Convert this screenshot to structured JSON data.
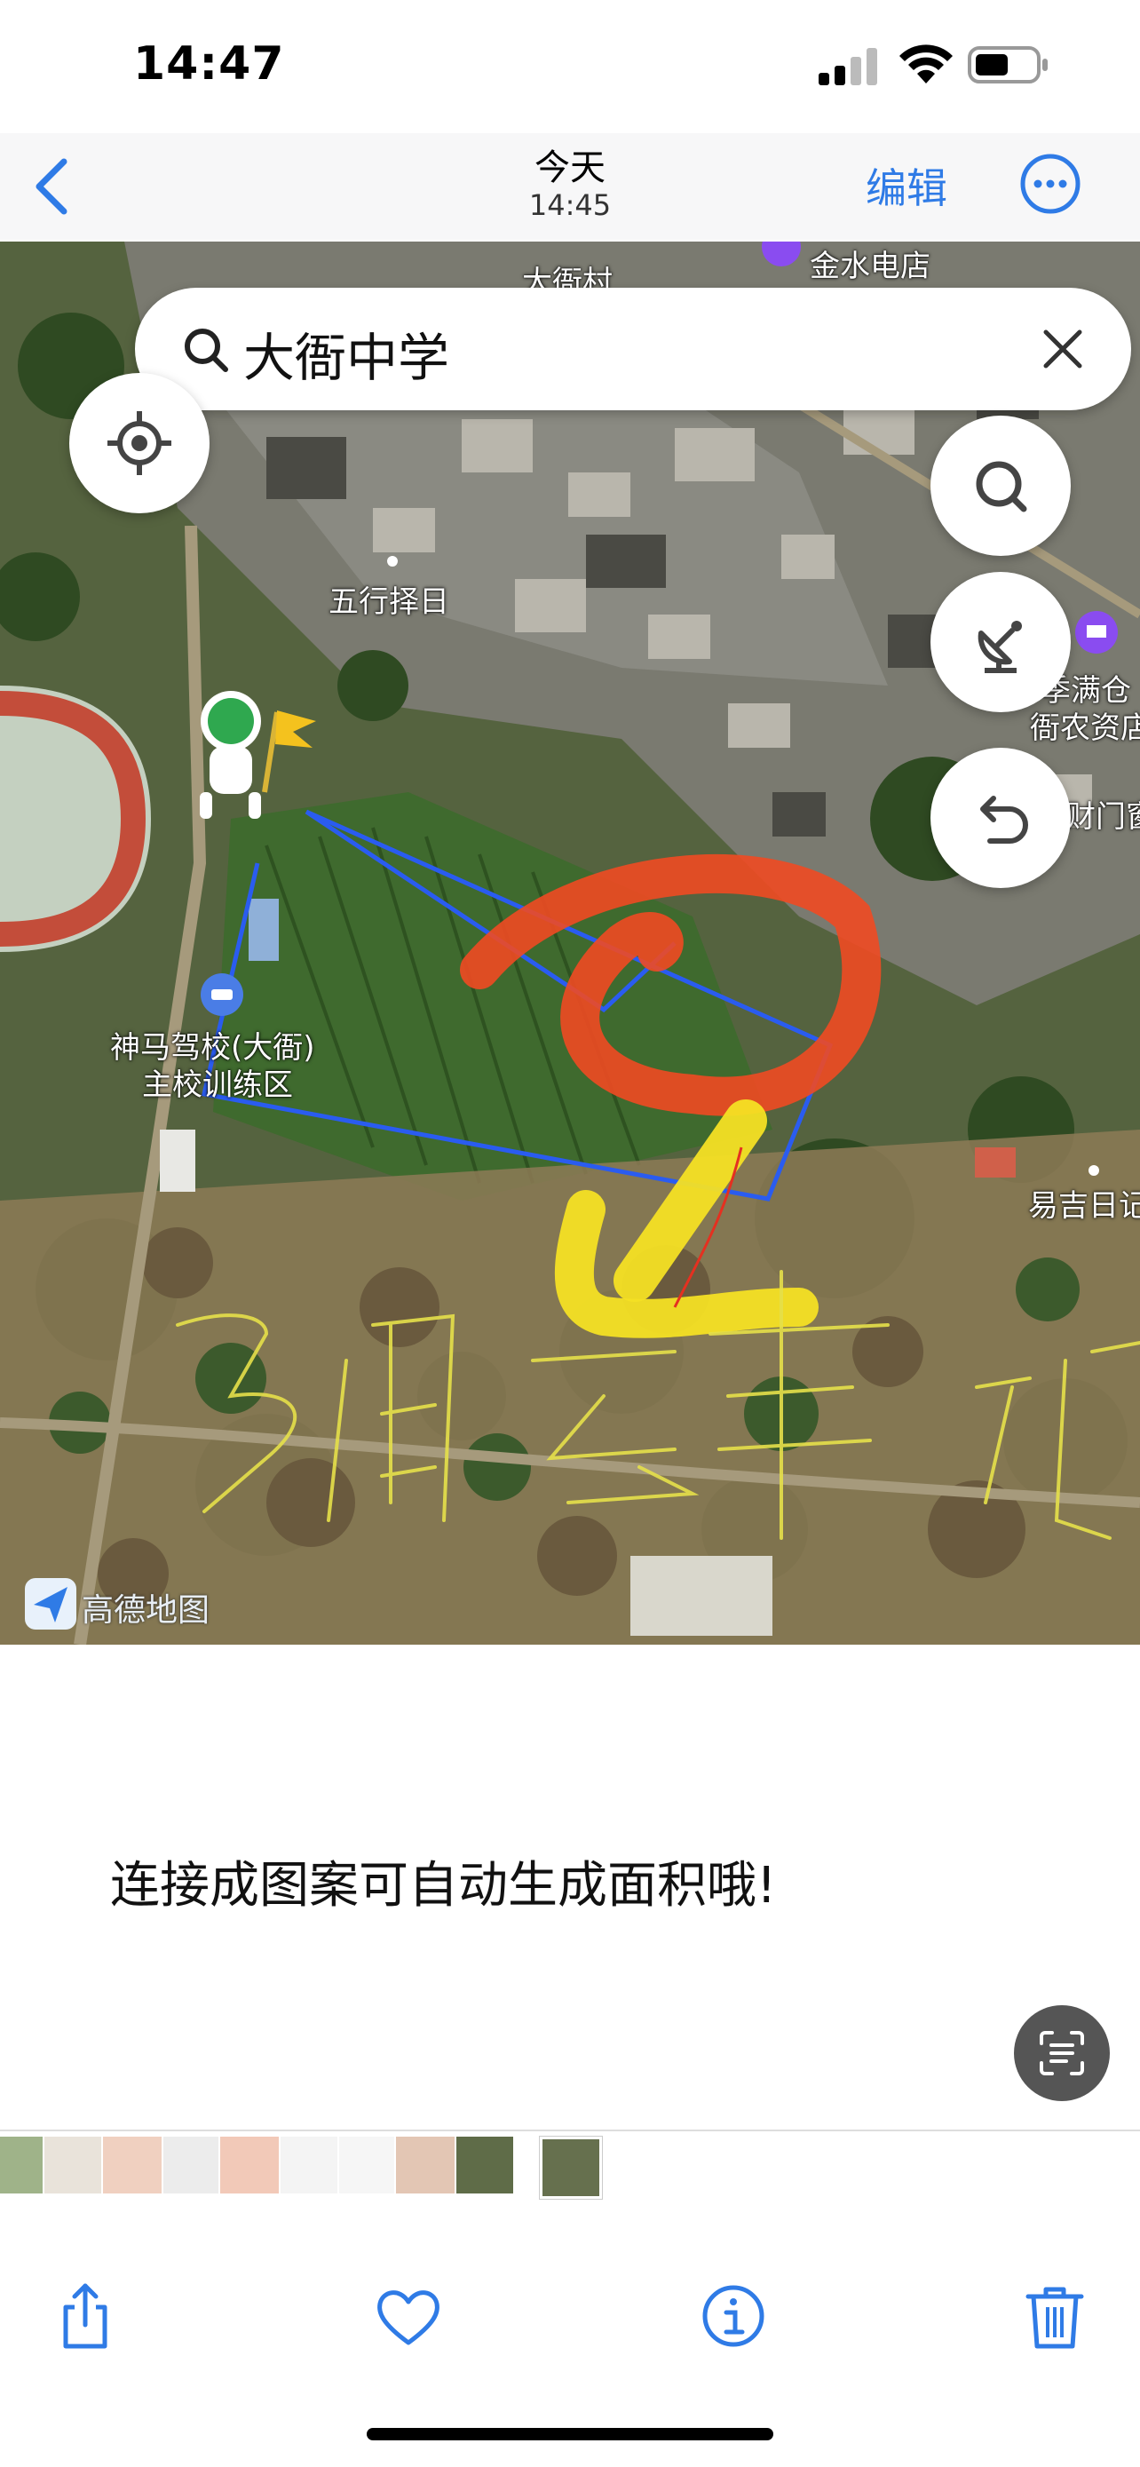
{
  "status": {
    "time": "14:47"
  },
  "nav": {
    "title": "今天",
    "subtitle": "14:45",
    "edit_label": "编辑"
  },
  "map": {
    "search_query": "大衙中学",
    "labels": {
      "village": "大衙村",
      "store": "金水电店",
      "wuxing": "五行择日",
      "school_line1": "神马驾校(大衙)",
      "school_line2": "主校训练区",
      "right1": "季满仓",
      "right2": "衙农资店",
      "right3": "财门窗",
      "right4": "易吉日记"
    },
    "watermark": "高德地图",
    "icons": [
      "locate-icon",
      "search-icon",
      "satellite-icon",
      "undo-icon",
      "close-icon"
    ]
  },
  "caption": "连接成图案可自动生成面积哦!",
  "toolbar": {
    "icons": [
      "share-icon",
      "heart-icon",
      "info-icon",
      "trash-icon"
    ]
  },
  "colors": {
    "accent": "#2f7be6",
    "boundary": "#2a5cf0",
    "red_stroke": "#f04a22",
    "yellow_stroke": "#f4e024"
  }
}
